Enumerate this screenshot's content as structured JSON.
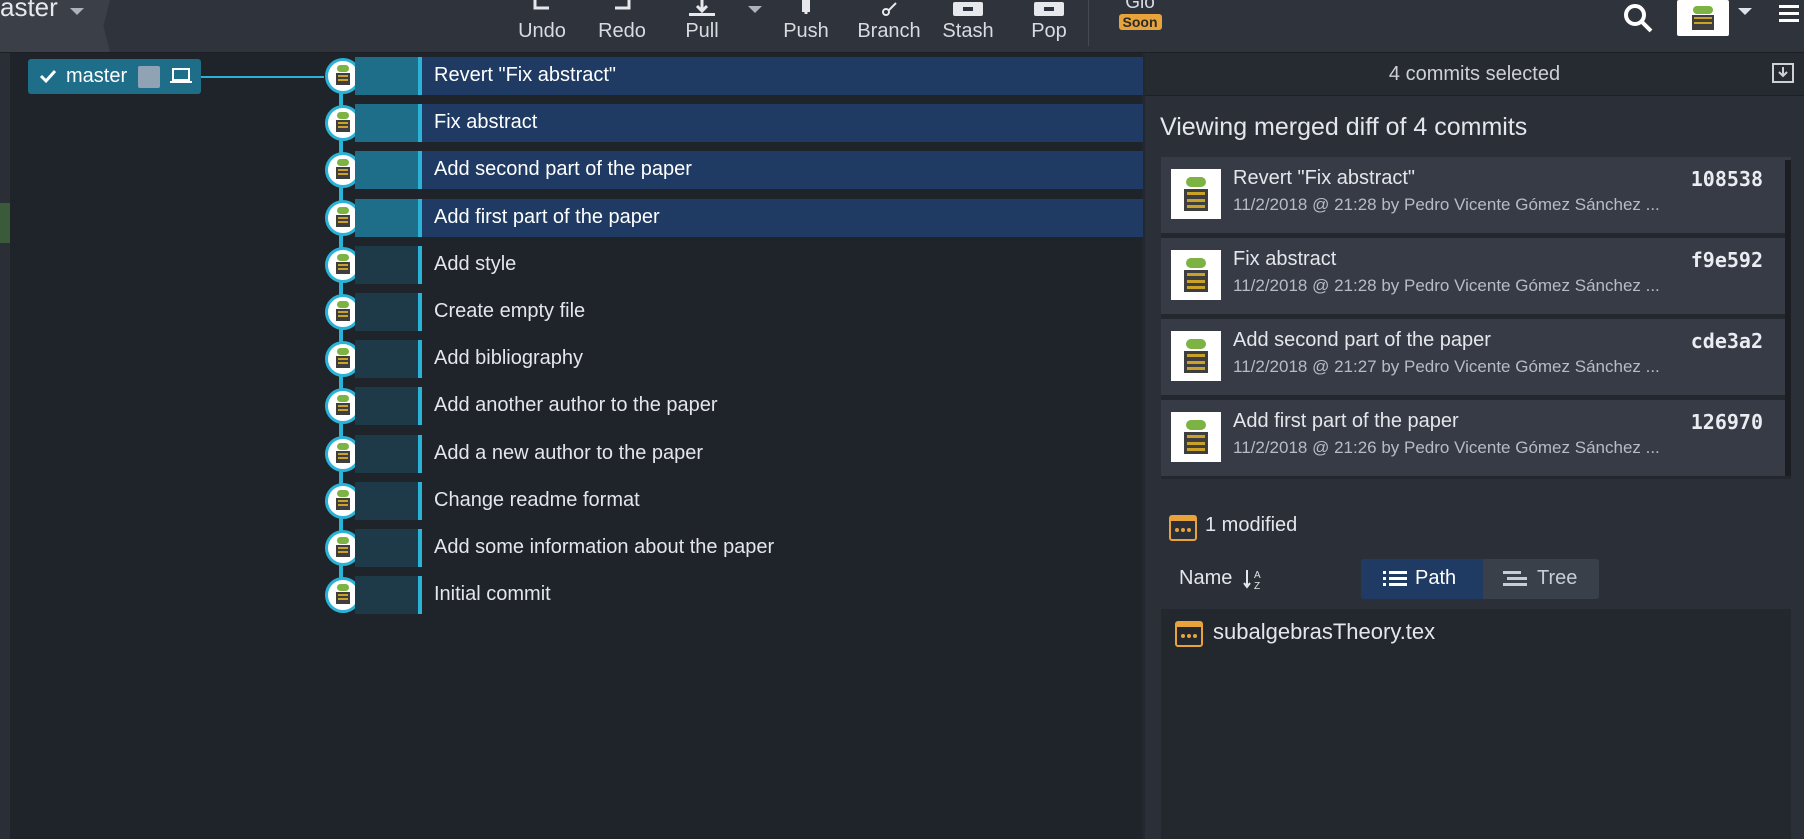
{
  "toolbar": {
    "branch_label": "aster",
    "undo": "Undo",
    "redo": "Redo",
    "pull": "Pull",
    "push": "Push",
    "branch": "Branch",
    "stash": "Stash",
    "pop": "Pop",
    "glo": "Glo",
    "glo_badge": "Soon"
  },
  "graph": {
    "branch_chip": "master",
    "commits": [
      {
        "message": "Revert \"Fix abstract\"",
        "selected": true
      },
      {
        "message": "Fix abstract",
        "selected": true
      },
      {
        "message": "Add second part of the paper",
        "selected": true
      },
      {
        "message": "Add first part of the paper",
        "selected": true
      },
      {
        "message": "Add style",
        "selected": false
      },
      {
        "message": "Create empty file",
        "selected": false
      },
      {
        "message": "Add bibliography",
        "selected": false
      },
      {
        "message": "Add another author to the paper",
        "selected": false
      },
      {
        "message": "Add a new author to the paper",
        "selected": false
      },
      {
        "message": "Change readme format",
        "selected": false
      },
      {
        "message": "Add some information about the paper",
        "selected": false
      },
      {
        "message": "Initial commit",
        "selected": false
      }
    ]
  },
  "panel": {
    "header": "4 commits selected",
    "merged_title": "Viewing merged diff of 4 commits",
    "commits": [
      {
        "title": "Revert \"Fix abstract\"",
        "meta": "11/2/2018 @ 21:28 by Pedro Vicente Gómez Sánchez ...",
        "sha": "108538"
      },
      {
        "title": "Fix abstract",
        "meta": "11/2/2018 @ 21:28 by Pedro Vicente Gómez Sánchez ...",
        "sha": "f9e592"
      },
      {
        "title": "Add second part of the paper",
        "meta": "11/2/2018 @ 21:27 by Pedro Vicente Gómez Sánchez ...",
        "sha": "cde3a2"
      },
      {
        "title": "Add first part of the paper",
        "meta": "11/2/2018 @ 21:26 by Pedro Vicente Gómez Sánchez ...",
        "sha": "126970"
      }
    ],
    "modified": "1 modified",
    "sort_label": "Name",
    "path_label": "Path",
    "tree_label": "Tree",
    "file": "subalgebrasTheory.tex"
  },
  "colors": {
    "accent": "#2ab3d6",
    "selected_row": "#1f3b63",
    "badge": "#e8a33a"
  }
}
